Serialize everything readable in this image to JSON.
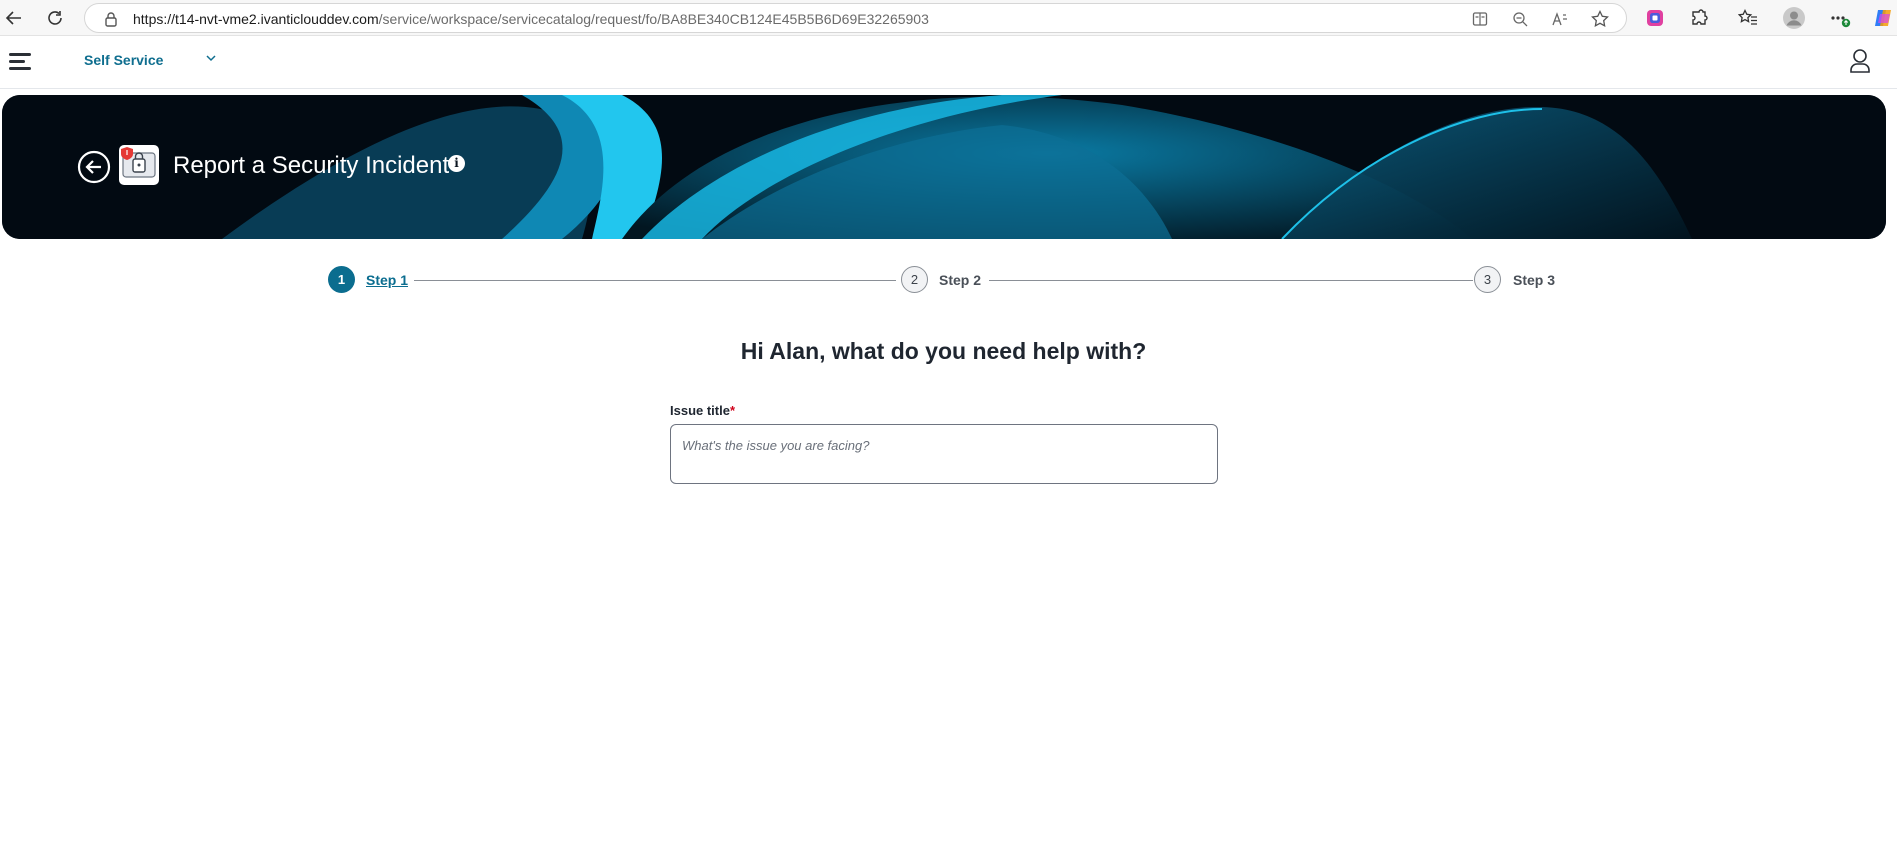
{
  "browser": {
    "url_host": "https://t14-nvt-vme2.ivanticlouddev.com",
    "url_path": "/service/workspace/servicecatalog/request/fo/BA8BE340CB124E45B5B6D69E32265903",
    "icons": [
      "back-arrow-icon",
      "refresh-icon",
      "lock-icon",
      "immersive-reader-icon",
      "zoom-out-icon",
      "read-aloud-icon",
      "favorite-star-icon",
      "color-extension-icon",
      "extensions-puzzle-icon",
      "favorites-icon",
      "profile-avatar-icon",
      "more-options-icon",
      "copilot-icon"
    ]
  },
  "header": {
    "workspace_label": "Self Service",
    "icons": [
      "hamburger-menu-icon",
      "chevron-down-icon",
      "user-profile-icon"
    ]
  },
  "banner": {
    "title": "Report a Security Incident",
    "info_glyph": "i",
    "icons": [
      "back-circle-icon",
      "security-incident-catalog-icon",
      "info-icon"
    ]
  },
  "stepper": {
    "steps": [
      {
        "number": "1",
        "label": "Step 1",
        "state": "active"
      },
      {
        "number": "2",
        "label": "Step 2",
        "state": "upcoming"
      },
      {
        "number": "3",
        "label": "Step 3",
        "state": "upcoming"
      }
    ]
  },
  "form": {
    "greeting": "Hi Alan, what do you need help with?",
    "issue_title_label": "Issue title",
    "required_marker": "*",
    "issue_title_placeholder": "What's the issue you are facing?",
    "issue_title_value": ""
  },
  "colors": {
    "accent": "#0b6d8f",
    "required": "#d0021b",
    "banner_bg": "#020a12",
    "banner_highlight": "#1ec0e8"
  }
}
